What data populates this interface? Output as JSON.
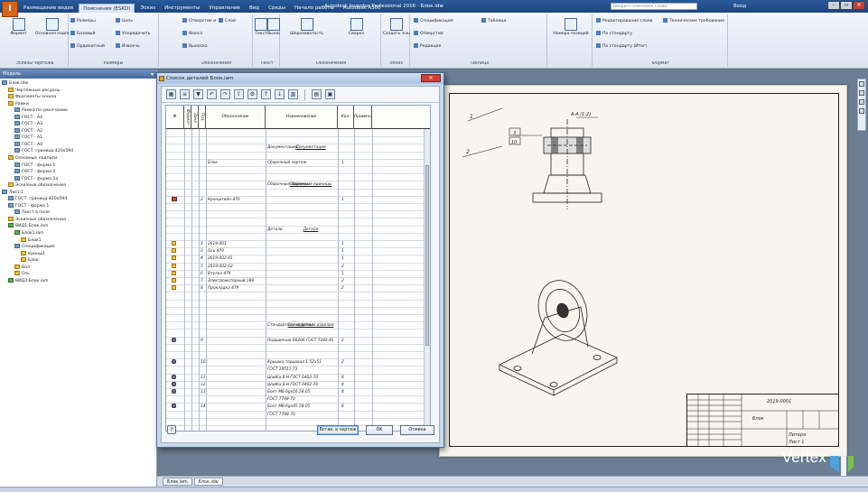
{
  "app": {
    "logo_letter": "I",
    "title": "Autodesk Inventor Professional 2016 - Блок.idw",
    "search_placeholder": "Введите ключевое слово",
    "user": "Вход",
    "win_min": "–",
    "win_max": "▫",
    "win_close": "✕",
    "tabs": [
      "Размещение видов",
      "Пояснения (ESKD)",
      "Эскиз",
      "Инструменты",
      "Управление",
      "Вид",
      "Среды",
      "Начало работы",
      "Autodesk A360"
    ],
    "active_tab_index": 1
  },
  "ribbon": {
    "groups": [
      {
        "label": "Эскизы чертежа",
        "buttons": [
          "Формат",
          "Основная надпись"
        ]
      },
      {
        "label": "Размеры",
        "buttons": [
          "Размеры",
          "Базовый",
          "Ординатный",
          "Цепь",
          "Упорядочить",
          "Извлечь"
        ]
      },
      {
        "label": "Обозначения",
        "buttons": [
          "Отверстие и резьба",
          "Фаска",
          "Выноска",
          "Слой"
        ]
      },
      {
        "label": "Текст",
        "buttons": [
          "Текст",
          "Выноска"
        ]
      },
      {
        "label": "Обозначения",
        "buttons": [
          "Шероховатость",
          "Сварка"
        ]
      },
      {
        "label": "Эскиз",
        "buttons": [
          "Создать эскиз"
        ]
      },
      {
        "label": "Таблица",
        "buttons": [
          "Спецификация",
          "Отверстия",
          "Редакция",
          "Таблица"
        ]
      },
      {
        "label": "",
        "buttons": [
          "Номера позиций"
        ]
      },
      {
        "label": "Формат",
        "buttons": [
          "Редактирование слоев",
          "По стандарту",
          "По стандарту (Итог)",
          "Технические требования"
        ]
      }
    ]
  },
  "browser": {
    "title": "Модель",
    "pin": "▾",
    "items": [
      {
        "label": "Блок.idw",
        "level": 0,
        "icon": "drawing"
      },
      {
        "label": "Чертёжные ресурсы",
        "level": 1,
        "icon": "folder"
      },
      {
        "label": "Фрагменты эскиза",
        "level": 1,
        "icon": "folder"
      },
      {
        "label": "Рамки",
        "level": 1,
        "icon": "folder"
      },
      {
        "label": "Рамка по умолчанию",
        "level": 2,
        "icon": "frame"
      },
      {
        "label": "ГОСТ - А4",
        "level": 2,
        "icon": "frame"
      },
      {
        "label": "ГОСТ - А3",
        "level": 2,
        "icon": "frame"
      },
      {
        "label": "ГОСТ - А2",
        "level": 2,
        "icon": "frame"
      },
      {
        "label": "ГОСТ - А1",
        "level": 2,
        "icon": "frame"
      },
      {
        "label": "ГОСТ - А0",
        "level": 2,
        "icon": "frame"
      },
      {
        "label": "ГОСТ. граница 420х594",
        "level": 2,
        "icon": "frame"
      },
      {
        "label": "Основные надписи",
        "level": 1,
        "icon": "folder"
      },
      {
        "label": "ГОСТ - форма 1",
        "level": 2,
        "icon": "frame"
      },
      {
        "label": "ГОСТ - форма 2",
        "level": 2,
        "icon": "frame"
      },
      {
        "label": "ГОСТ - форма 2а",
        "level": 2,
        "icon": "frame"
      },
      {
        "label": "Эскизные обозначения",
        "level": 1,
        "icon": "folder"
      },
      {
        "label": "Лист:1",
        "level": 0,
        "icon": "sheet"
      },
      {
        "label": "ГОСТ. граница 420х594",
        "level": 1,
        "icon": "frame"
      },
      {
        "label": "ГОСТ - форма 1",
        "level": 1,
        "icon": "frame"
      },
      {
        "label": "Текст в поле",
        "level": 2,
        "icon": "text"
      },
      {
        "label": "Эскизные обозначения",
        "level": 1,
        "icon": "folder"
      },
      {
        "label": "ВИД1:Блок.iam",
        "level": 1,
        "icon": "view"
      },
      {
        "label": "Блок1.iam",
        "level": 2,
        "icon": "view"
      },
      {
        "label": "Блок1",
        "level": 3,
        "icon": "part"
      },
      {
        "label": "Спецификация",
        "level": 2,
        "icon": "bom"
      },
      {
        "label": "Кронш1",
        "level": 3,
        "icon": "part"
      },
      {
        "label": "Блок",
        "level": 3,
        "icon": "part"
      },
      {
        "label": "Вал",
        "level": 2,
        "icon": "part"
      },
      {
        "label": "Ось",
        "level": 2,
        "icon": "part"
      },
      {
        "label": "ВИД3:Блок.iam",
        "level": 1,
        "icon": "view"
      }
    ]
  },
  "dialog": {
    "title": "Список деталей Блок.iam",
    "close": "✕",
    "toolbar_icons": [
      "table-icon",
      "sort-icon",
      "filter-icon",
      "undo-icon",
      "redo-icon",
      "export-icon",
      "settings-icon",
      "sort-ascending-icon",
      "sort-descending-icon",
      "columns-icon",
      "spacer",
      "grid-icon",
      "save-icon"
    ],
    "columns": [
      "Ф",
      "Формат",
      "Зона",
      "Поз.",
      "Обозначение",
      "Наименование",
      "Кол.",
      "Примечание"
    ],
    "rows": [
      {
        "kind": "blank"
      },
      {
        "kind": "blank"
      },
      {
        "kind": "section",
        "name": "Документация"
      },
      {
        "kind": "blank"
      },
      {
        "kind": "item",
        "designation": "Блок",
        "name": "Сборочный чертеж",
        "qty": "1"
      },
      {
        "kind": "blank"
      },
      {
        "kind": "blank"
      },
      {
        "kind": "section",
        "name": "Сборочные единицы"
      },
      {
        "kind": "blank"
      },
      {
        "kind": "item",
        "icon": "red",
        "pos": "2",
        "designation": "Кронштейн-470",
        "qty": "1"
      },
      {
        "kind": "blank"
      },
      {
        "kind": "blank"
      },
      {
        "kind": "blank"
      },
      {
        "kind": "section",
        "name": "Детали"
      },
      {
        "kind": "blank"
      },
      {
        "kind": "item",
        "icon": "yellow",
        "pos": "1",
        "designation": "2019-001",
        "qty": "1"
      },
      {
        "kind": "item",
        "icon": "yellow",
        "pos": "3",
        "designation": "Ось 479",
        "qty": "1"
      },
      {
        "kind": "item",
        "icon": "yellow",
        "pos": "4",
        "designation": "2019-002-01",
        "qty": "1"
      },
      {
        "kind": "item",
        "icon": "yellow",
        "pos": "5",
        "designation": "2019-002-02",
        "qty": "2"
      },
      {
        "kind": "item",
        "icon": "yellow",
        "pos": "6",
        "designation": "Втулка 479",
        "qty": "1"
      },
      {
        "kind": "item",
        "icon": "yellow",
        "pos": "7",
        "designation": "Электромоторный 189",
        "qty": "2"
      },
      {
        "kind": "item",
        "icon": "yellow",
        "pos": "8",
        "designation": "Прокладка 479",
        "qty": "2"
      },
      {
        "kind": "blank"
      },
      {
        "kind": "blank"
      },
      {
        "kind": "blank"
      },
      {
        "kind": "blank"
      },
      {
        "kind": "section",
        "name": "Стандартные изделия"
      },
      {
        "kind": "blank"
      },
      {
        "kind": "item",
        "icon": "gear",
        "pos": "9",
        "name": "Подшипник 60206 ГОСТ 7242-81",
        "qty": "2"
      },
      {
        "kind": "blank"
      },
      {
        "kind": "blank"
      },
      {
        "kind": "item",
        "icon": "gear",
        "pos": "10",
        "name": "Крышка торцовая 1-52х51",
        "qty": "2"
      },
      {
        "kind": "item",
        "name": "ГОСТ 18511-73"
      },
      {
        "kind": "item",
        "icon": "gear",
        "pos": "11",
        "name": "Шайба 8 Н ГОСТ 6402-70",
        "qty": "8"
      },
      {
        "kind": "item",
        "icon": "gear",
        "pos": "12",
        "name": "Шайба 8 Н ГОСТ 6402-70",
        "qty": "4"
      },
      {
        "kind": "item",
        "icon": "gear",
        "pos": "13",
        "name": "Болт М6-6gх16.58.05",
        "qty": "4"
      },
      {
        "kind": "item",
        "name": "ГОСТ 7798-70"
      },
      {
        "kind": "item",
        "icon": "gear",
        "pos": "14",
        "name": "Болт М8-6gх45.58.05",
        "qty": "8"
      },
      {
        "kind": "item",
        "name": "ГОСТ 7798-70"
      },
      {
        "kind": "blank"
      },
      {
        "kind": "blank"
      },
      {
        "kind": "blank"
      },
      {
        "kind": "blank"
      }
    ],
    "buttons": {
      "insert": "Встав. в чертеж",
      "ok": "OK",
      "cancel": "Отмена",
      "help": "?"
    }
  },
  "drawing": {
    "scale_label": "А-А (1:2)",
    "labels": [
      "1",
      "2",
      "3",
      "10"
    ],
    "title_block": {
      "designation": "2019-0001",
      "name": "Блок",
      "material": "Литера",
      "sheet_info": "Лист 1"
    }
  },
  "doc_tabs": [
    "Блок.iam",
    "Блок.idw"
  ],
  "doc_tab_active": 1,
  "watermark": "Vertex",
  "colors": {
    "accent": "#2a5a9c",
    "ribbon": "#dce5f0",
    "graphics_bg": "#6b7e94",
    "sheet": "#f7f5ee"
  }
}
